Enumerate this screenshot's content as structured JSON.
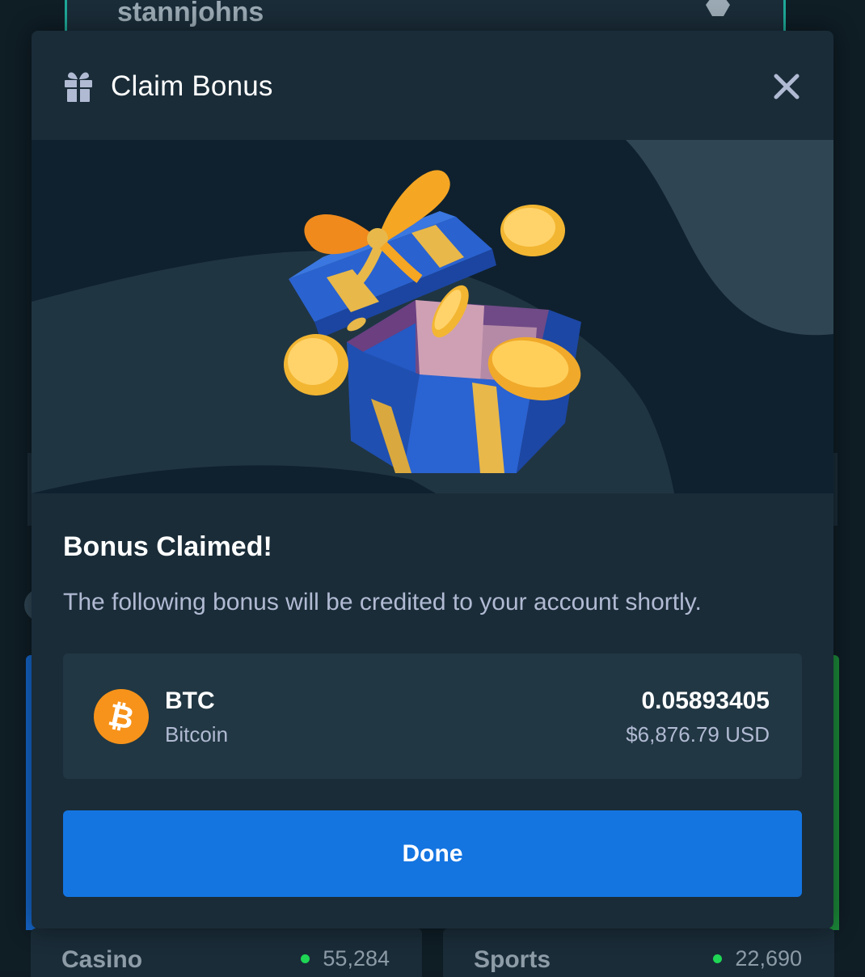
{
  "background": {
    "username": "stannjohns",
    "cards": [
      {
        "label": "Casino",
        "count": "55,284"
      },
      {
        "label": "Sports",
        "count": "22,690"
      }
    ]
  },
  "modal": {
    "title": "Claim Bonus",
    "title_icon": "gift-icon",
    "close_icon": "close-icon",
    "heading": "Bonus Claimed!",
    "description": "The following bonus will be credited to your account shortly.",
    "reward": {
      "icon": "bitcoin-icon",
      "symbol": "BTC",
      "name": "Bitcoin",
      "amount": "0.05893405",
      "usd_value": "$6,876.79 USD"
    },
    "done_label": "Done"
  },
  "colors": {
    "modal_bg": "#1a2c38",
    "card_bg": "#213743",
    "hero_bg": "#0f212e",
    "button_blue": "#1475e1",
    "muted_text": "#b1bad3",
    "bitcoin_orange": "#f7931a",
    "online_green": "#1fd655"
  }
}
